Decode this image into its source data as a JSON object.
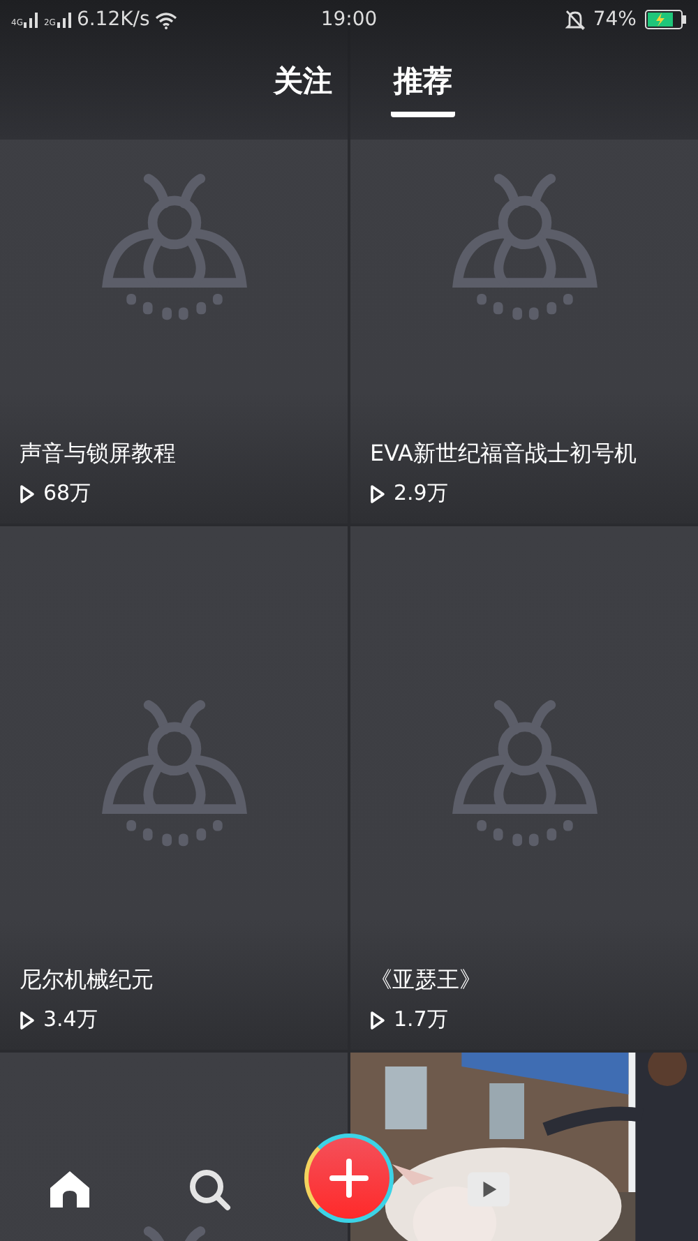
{
  "status_bar": {
    "signal_1": "4G",
    "signal_2": "2G",
    "network_speed": "6.12K/s",
    "time": "19:00",
    "battery": "74%"
  },
  "tabs": [
    {
      "label": "关注",
      "selected": false
    },
    {
      "label": "推荐",
      "selected": true
    }
  ],
  "videos": [
    {
      "kind": "placeholder",
      "title": "声音与锁屏教程",
      "plays": "68万"
    },
    {
      "kind": "placeholder",
      "title": "EVA新世纪福音战士初号机",
      "plays": "2.9万"
    },
    {
      "kind": "placeholder",
      "title": "尼尔机械纪元",
      "plays": "3.4万"
    },
    {
      "kind": "placeholder",
      "title": "《亚瑟王》",
      "plays": "1.7万"
    },
    {
      "kind": "placeholder"
    },
    {
      "kind": "picture"
    }
  ],
  "bottom_nav": [
    {
      "kind": "home"
    },
    {
      "kind": "search"
    },
    {
      "kind": "add"
    },
    {
      "kind": "play"
    }
  ]
}
